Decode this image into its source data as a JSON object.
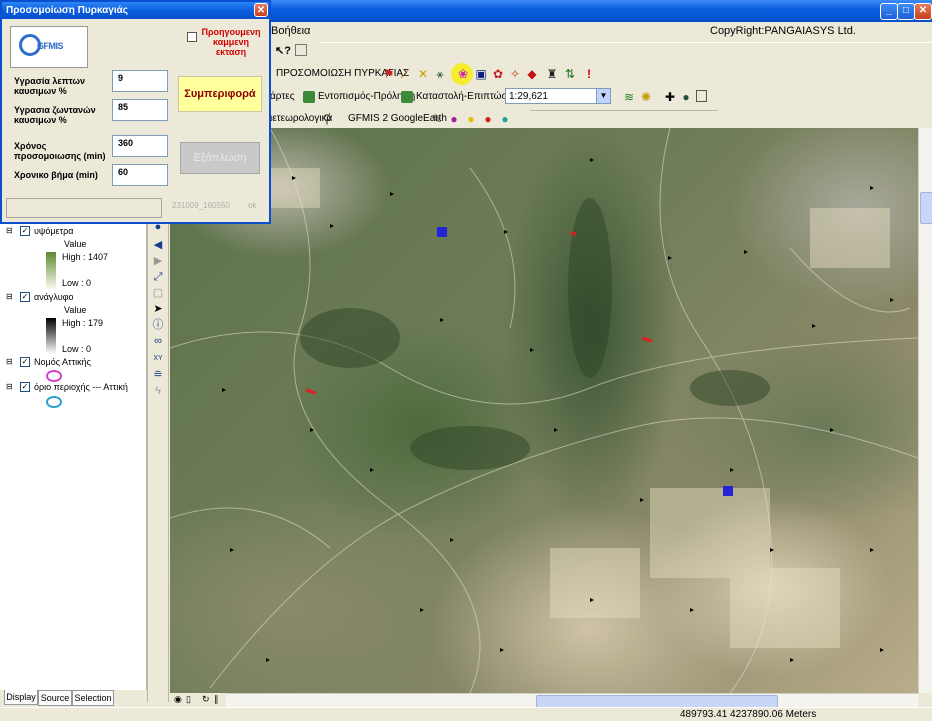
{
  "main_window": {
    "menu": {
      "help": "Βοήθεια"
    },
    "copyright": "CopyRight:PANGAIASYS Ltd."
  },
  "toolbar1": {
    "fire_sim_label": "ΠΡΟΣΟΜΟΙΩΣΗ ΠΥΡΚΑΓΙΑΣ"
  },
  "toolbar2": {
    "maps_label": "άρτες",
    "detection_label": "Εντοπισμός-Πρόληψη",
    "suppression_label": "Καταστολή-Επιπτώσεις",
    "scale_value": "1:29,621"
  },
  "toolbar3": {
    "meteo_label": "ιετεωρολογικά",
    "gfmis_ge_label": "GFMIS 2 GoogleEarth"
  },
  "dialog": {
    "title": "Προσομοίωση Πυρκαγιάς",
    "logo_text": "GFMIS",
    "prev_burned_label": "Προηγουμενη καμμενη εκταση",
    "fields": [
      {
        "label": "Υγρασία λεπτων καυσιμων %",
        "value": "9"
      },
      {
        "label": "Υγρασια ζωντανών καυσιμων %",
        "value": "85"
      },
      {
        "label": "Χρόνος προσομοιωσης (min)",
        "value": "360"
      },
      {
        "label": "Χρονικο βήμα (min)",
        "value": "60"
      }
    ],
    "behavior_button": "Συμπεριφορά",
    "spread_button": "Εξάπλωση",
    "status_progress": "231009_180550",
    "status_ok": "ok"
  },
  "toc": {
    "layers": [
      {
        "name": "υψόμετρα",
        "checked": true,
        "legend_title": "Value",
        "high": "High : 1407",
        "low": "Low : 0",
        "ramp_colors": [
          "#5c8a2e",
          "#f4f8e8"
        ]
      },
      {
        "name": "ανάγλυφο",
        "checked": true,
        "legend_title": "Value",
        "high": "High : 179",
        "low": "Low : 0",
        "ramp_colors": [
          "#000000",
          "#ffffff"
        ]
      },
      {
        "name": "Νομός Αττικής",
        "checked": true,
        "symbol_color": "#d43fd4"
      },
      {
        "name": "όριο περιοχής --- Αττική",
        "checked": true,
        "symbol_color": "#2aa0d4"
      }
    ],
    "tabs": [
      "Display",
      "Source",
      "Selection"
    ],
    "active_tab": "Display"
  },
  "status": {
    "coords": "489793.41  4237890.06 Meters"
  },
  "colors": {
    "title_blue": "#0a5ee0",
    "behavior_bg": "#ffff9c",
    "marker_blue": "#2323d8",
    "fire_red": "#e02020"
  }
}
